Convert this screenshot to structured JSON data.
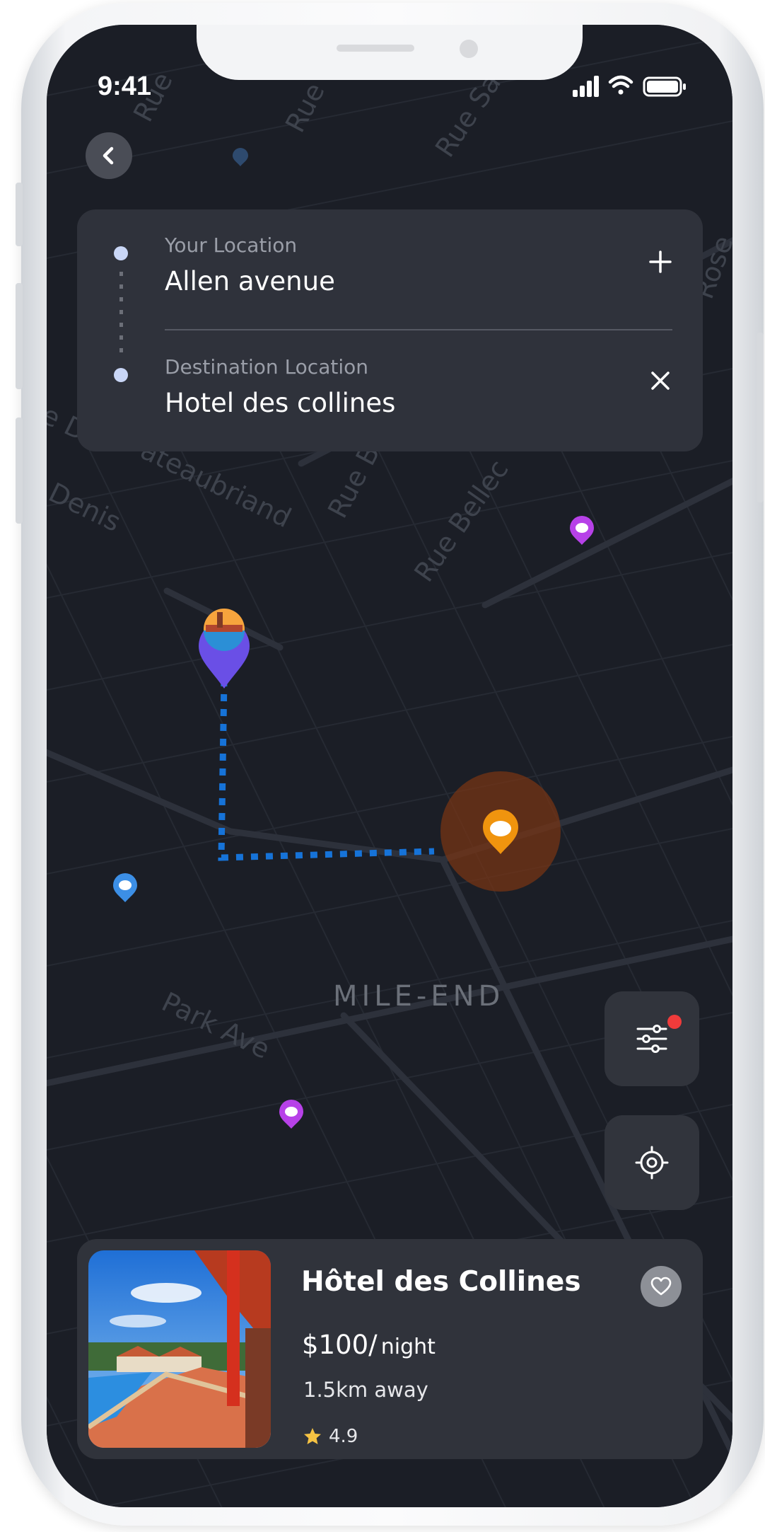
{
  "status_bar": {
    "time": "9:41"
  },
  "route": {
    "origin_label": "Your Location",
    "origin_value": "Allen avenue",
    "destination_label": "Destination Location",
    "destination_value": "Hotel des collines"
  },
  "map": {
    "district_label": "MILE-END",
    "streets": [
      {
        "name": "Park Ave"
      },
      {
        "name": "Rue Bellec"
      },
      {
        "name": "ateaubriand"
      },
      {
        "name": "Rue B"
      },
      {
        "name": "Denis"
      },
      {
        "name": "Rue"
      },
      {
        "name": "Rue Sa"
      },
      {
        "name": "Rose"
      },
      {
        "name": "e D"
      },
      {
        "name": "Rue"
      }
    ]
  },
  "hotel": {
    "name": "Hôtel des Collines",
    "price": "$100/",
    "price_unit": "night",
    "distance": "1.5km away",
    "rating": "4.9"
  },
  "icons": {
    "back": "chevron-left-icon",
    "add_stop": "plus-icon",
    "clear_destination": "close-icon",
    "filter": "sliders-icon",
    "locate": "crosshair-icon",
    "favorite": "heart-icon",
    "rating": "star-icon"
  },
  "colors": {
    "background": "#1b1e26",
    "card": "#2f323b",
    "route": "#1673d8",
    "accent_orange": "#f0940e",
    "pin_purple": "#b741e8",
    "pin_blue": "#3c8fe6",
    "notification": "#ef3b3b",
    "star": "#f6c343"
  }
}
